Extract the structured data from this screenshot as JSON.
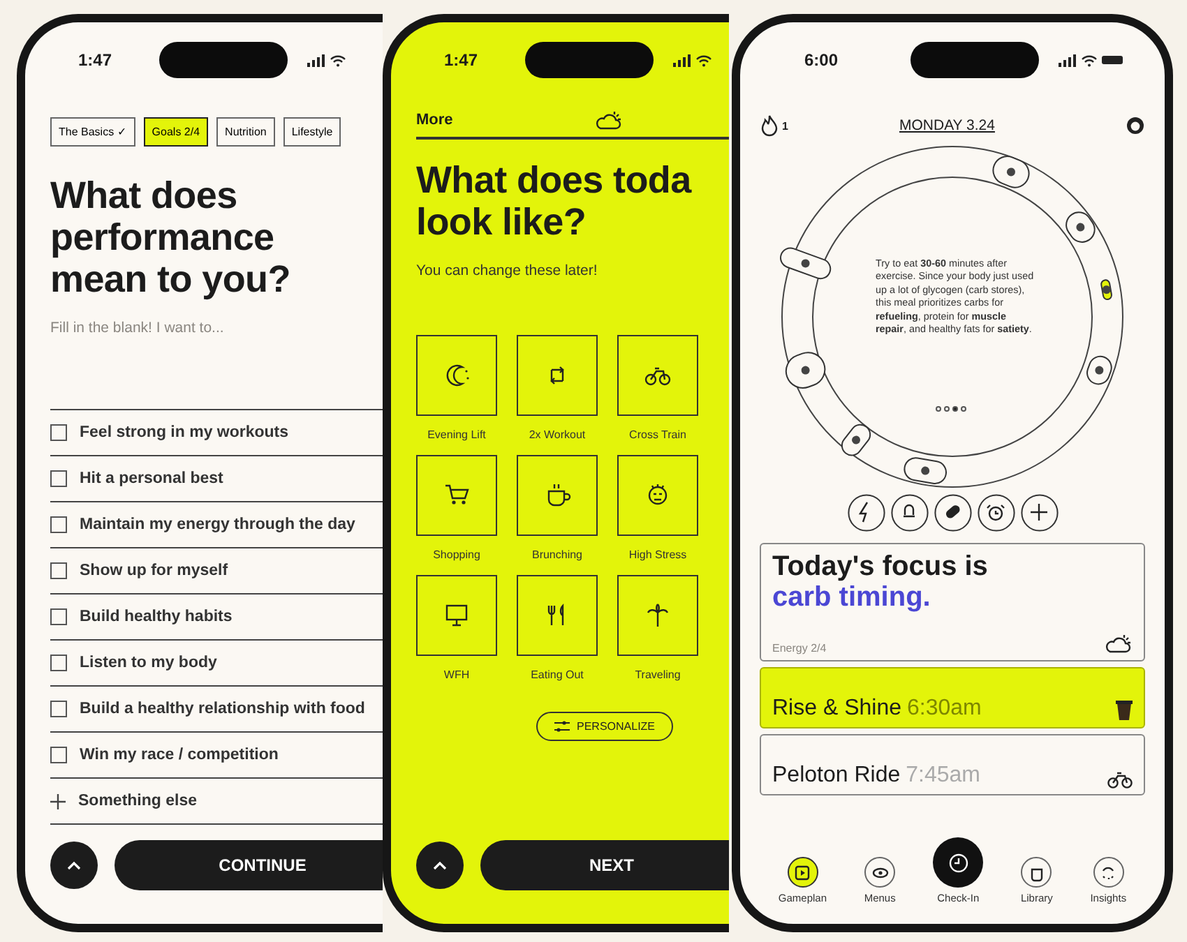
{
  "goals_phone": {
    "status_time": "1:47",
    "tabs": [
      {
        "label": "The Basics ✓",
        "selected": false
      },
      {
        "label": "Goals 2/4",
        "selected": true
      },
      {
        "label": "Nutrition",
        "selected": false
      },
      {
        "label": "Lifestyle",
        "selected": false
      }
    ],
    "title": "What does performance mean to you?",
    "subtitle": "Fill in the blank! I want to...",
    "options": [
      {
        "kind": "checkbox",
        "label": "Feel strong in my workouts",
        "checked": false
      },
      {
        "kind": "checkbox",
        "label": "Hit a personal best",
        "checked": false
      },
      {
        "kind": "checkbox",
        "label": "Maintain my energy through the day",
        "checked": false
      },
      {
        "kind": "checkbox",
        "label": "Show up for myself",
        "checked": false
      },
      {
        "kind": "checkbox",
        "label": "Build healthy habits",
        "checked": false
      },
      {
        "kind": "checkbox",
        "label": "Listen to my body",
        "checked": false
      },
      {
        "kind": "checkbox",
        "label": "Build a healthy relationship with food",
        "checked": false
      },
      {
        "kind": "checkbox",
        "label": "Win my race / competition",
        "checked": false
      },
      {
        "kind": "add",
        "label": "Something else"
      }
    ],
    "continue_label": "CONTINUE"
  },
  "day_phone": {
    "status_time": "1:47",
    "header_label": "More",
    "title": "What does toda look like?",
    "subtitle": "You can change these later!",
    "tiles": [
      {
        "label": "Evening Lift"
      },
      {
        "label": "2x Workout"
      },
      {
        "label": "Cross Train"
      },
      {
        "label": "Shopping"
      },
      {
        "label": "Brunching"
      },
      {
        "label": "High Stress"
      },
      {
        "label": "WFH"
      },
      {
        "label": "Eating Out"
      },
      {
        "label": "Traveling"
      }
    ],
    "personalize_label": "PERSONALIZE",
    "next_label": "NEXT"
  },
  "gameplan_phone": {
    "status_time": "6:00",
    "streak": "1",
    "date": "MONDAY 3.24",
    "ring_text": "Try to eat **30-60** minutes after exercise. Since your body just used up a lot of glycogen (carb stores), this meal prioritizes carbs for **refueling**, protein for **muscle repair**, and healthy fats for **satiety**.",
    "pager": [
      {
        "selected": false
      },
      {
        "selected": false
      },
      {
        "selected": true
      },
      {
        "selected": false
      }
    ],
    "focus": {
      "title": "Today's focus is",
      "highlight": "carb timing.",
      "energy": "Energy 2/4"
    },
    "meals": [
      {
        "kind": "highlight",
        "name": "Rise & Shine",
        "time": "6:30am"
      },
      {
        "kind": "plain",
        "name": "Peloton Ride",
        "time": "7:45am"
      }
    ],
    "nav": [
      {
        "kind": "tab",
        "label": "Gameplan",
        "selected": true
      },
      {
        "kind": "tab",
        "label": "Menus",
        "selected": false
      },
      {
        "kind": "primary",
        "label": "Check-In",
        "selected": false
      },
      {
        "kind": "tab",
        "label": "Library",
        "selected": false
      },
      {
        "kind": "tab",
        "label": "Insights",
        "selected": false
      }
    ]
  }
}
